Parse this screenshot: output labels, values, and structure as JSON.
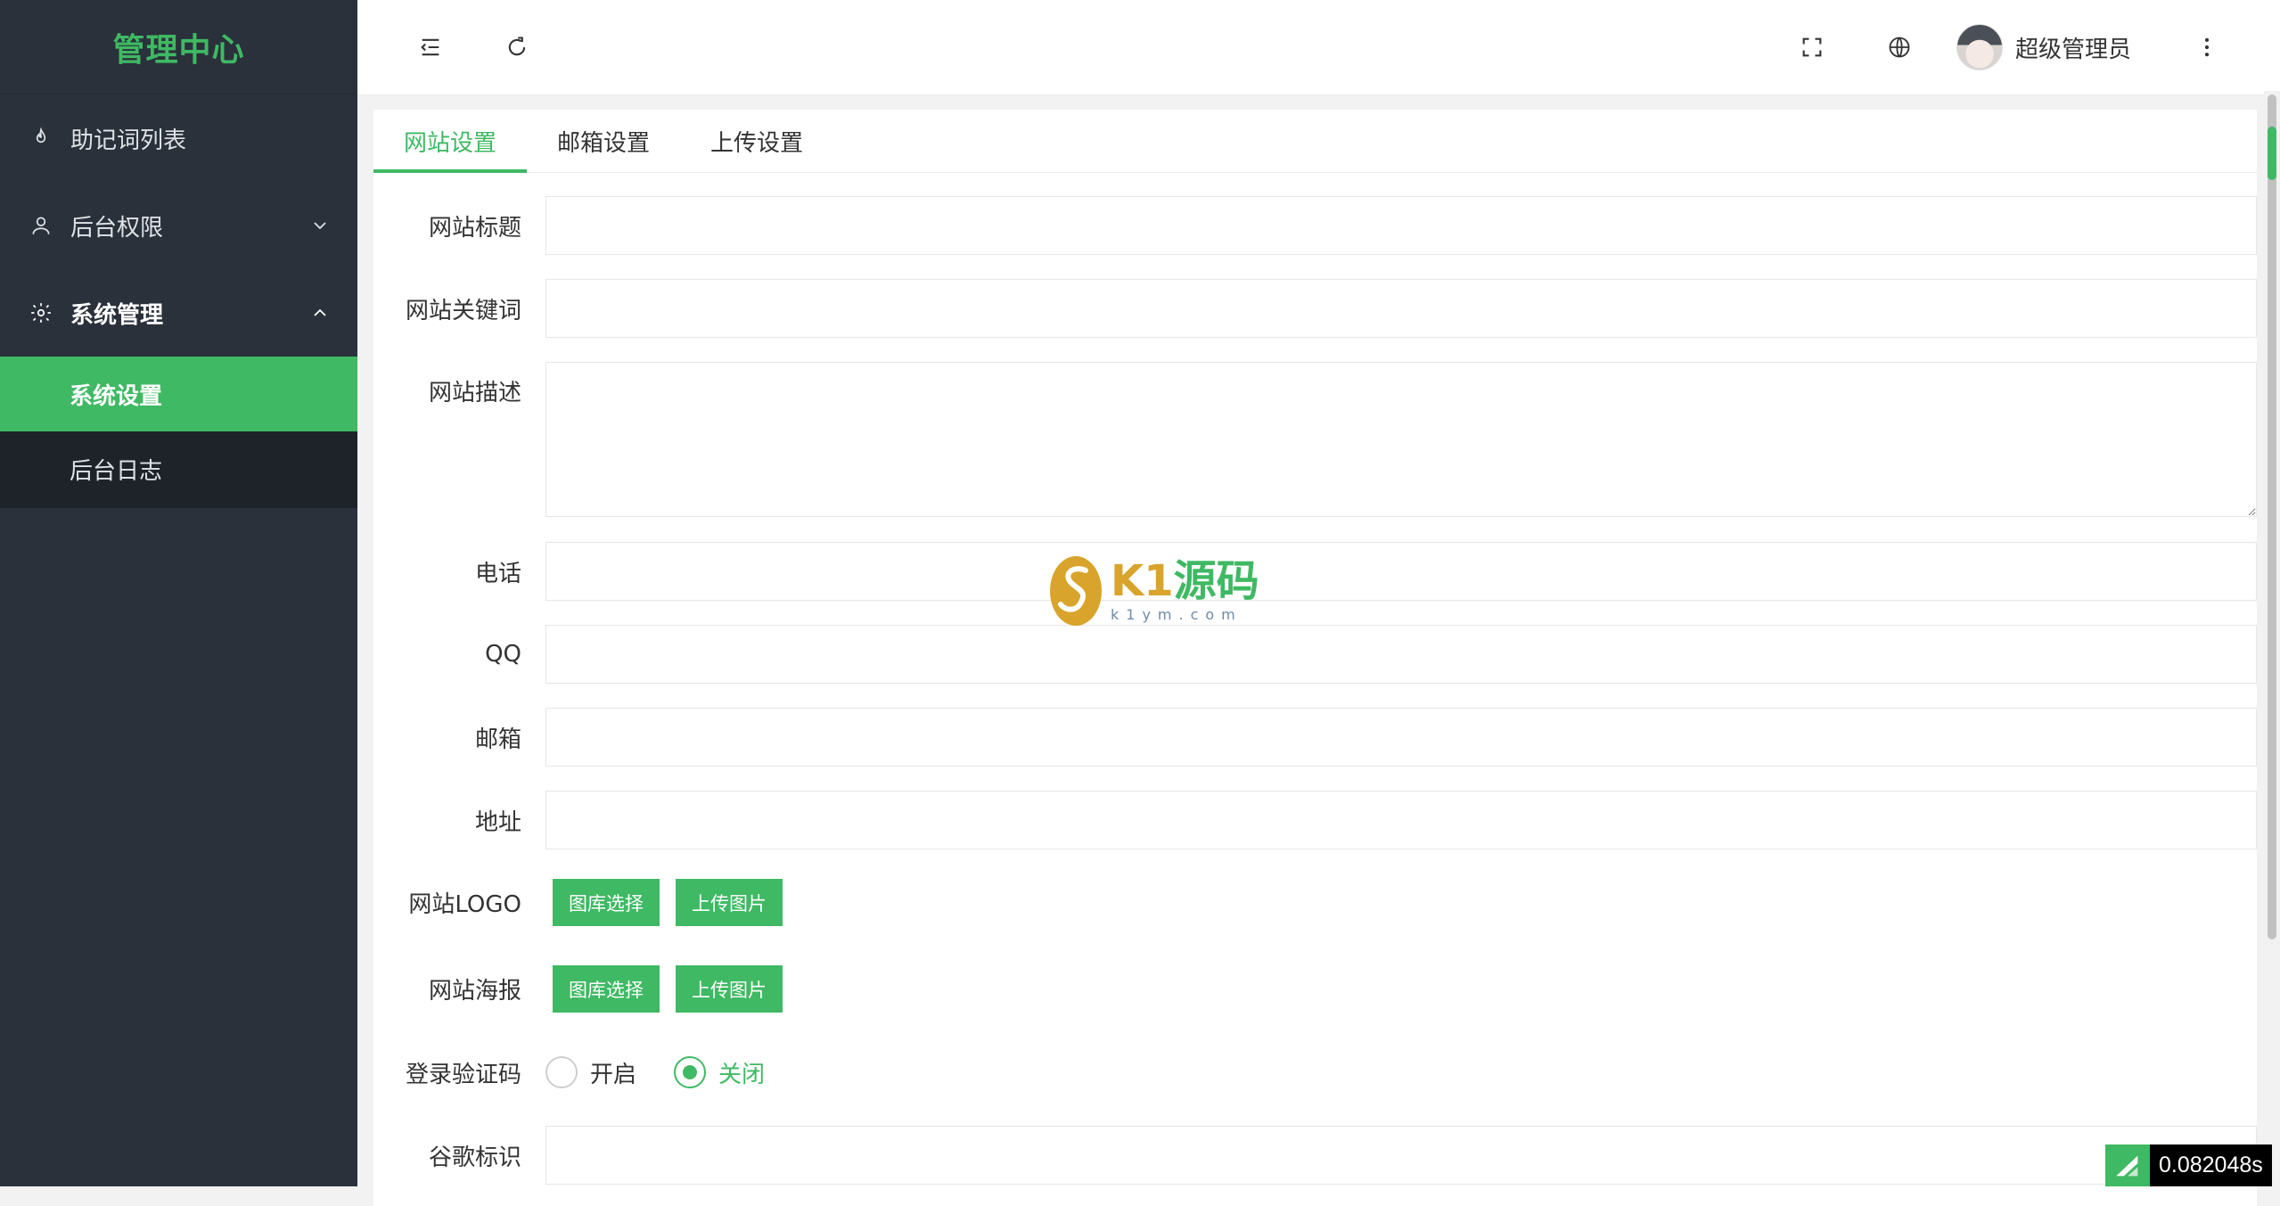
{
  "sidebar": {
    "title": "管理中心",
    "items": [
      {
        "label": "助记词列表",
        "icon": "fire-icon"
      },
      {
        "label": "后台权限",
        "icon": "user-icon"
      },
      {
        "label": "系统管理",
        "icon": "gear-icon"
      }
    ],
    "submenu": [
      {
        "label": "系统设置",
        "active": true
      },
      {
        "label": "后台日志",
        "active": false
      }
    ]
  },
  "header": {
    "user_name": "超级管理员"
  },
  "tabs": [
    {
      "label": "网站设置",
      "active": true
    },
    {
      "label": "邮箱设置",
      "active": false
    },
    {
      "label": "上传设置",
      "active": false
    }
  ],
  "form": {
    "site_title": {
      "label": "网站标题",
      "value": ""
    },
    "site_keywords": {
      "label": "网站关键词",
      "value": ""
    },
    "site_description": {
      "label": "网站描述",
      "value": ""
    },
    "phone": {
      "label": "电话",
      "value": ""
    },
    "qq": {
      "label": "QQ",
      "value": ""
    },
    "email": {
      "label": "邮箱",
      "value": ""
    },
    "address": {
      "label": "地址",
      "value": ""
    },
    "site_logo": {
      "label": "网站LOGO",
      "gallery_button": "图库选择",
      "upload_button": "上传图片"
    },
    "site_poster": {
      "label": "网站海报",
      "gallery_button": "图库选择",
      "upload_button": "上传图片"
    },
    "login_captcha": {
      "label": "登录验证码",
      "options": [
        "开启",
        "关闭"
      ],
      "selected": "关闭"
    },
    "google_id": {
      "label": "谷歌标识",
      "value": ""
    }
  },
  "watermark": {
    "main_a": "K1",
    "main_b": "源码",
    "sub": "k1ym.com"
  },
  "timer": {
    "value": "0.082048s"
  },
  "colors": {
    "accent": "#3fb963",
    "sidebar_bg": "#2a313b",
    "submenu_bg": "#1e232a"
  }
}
